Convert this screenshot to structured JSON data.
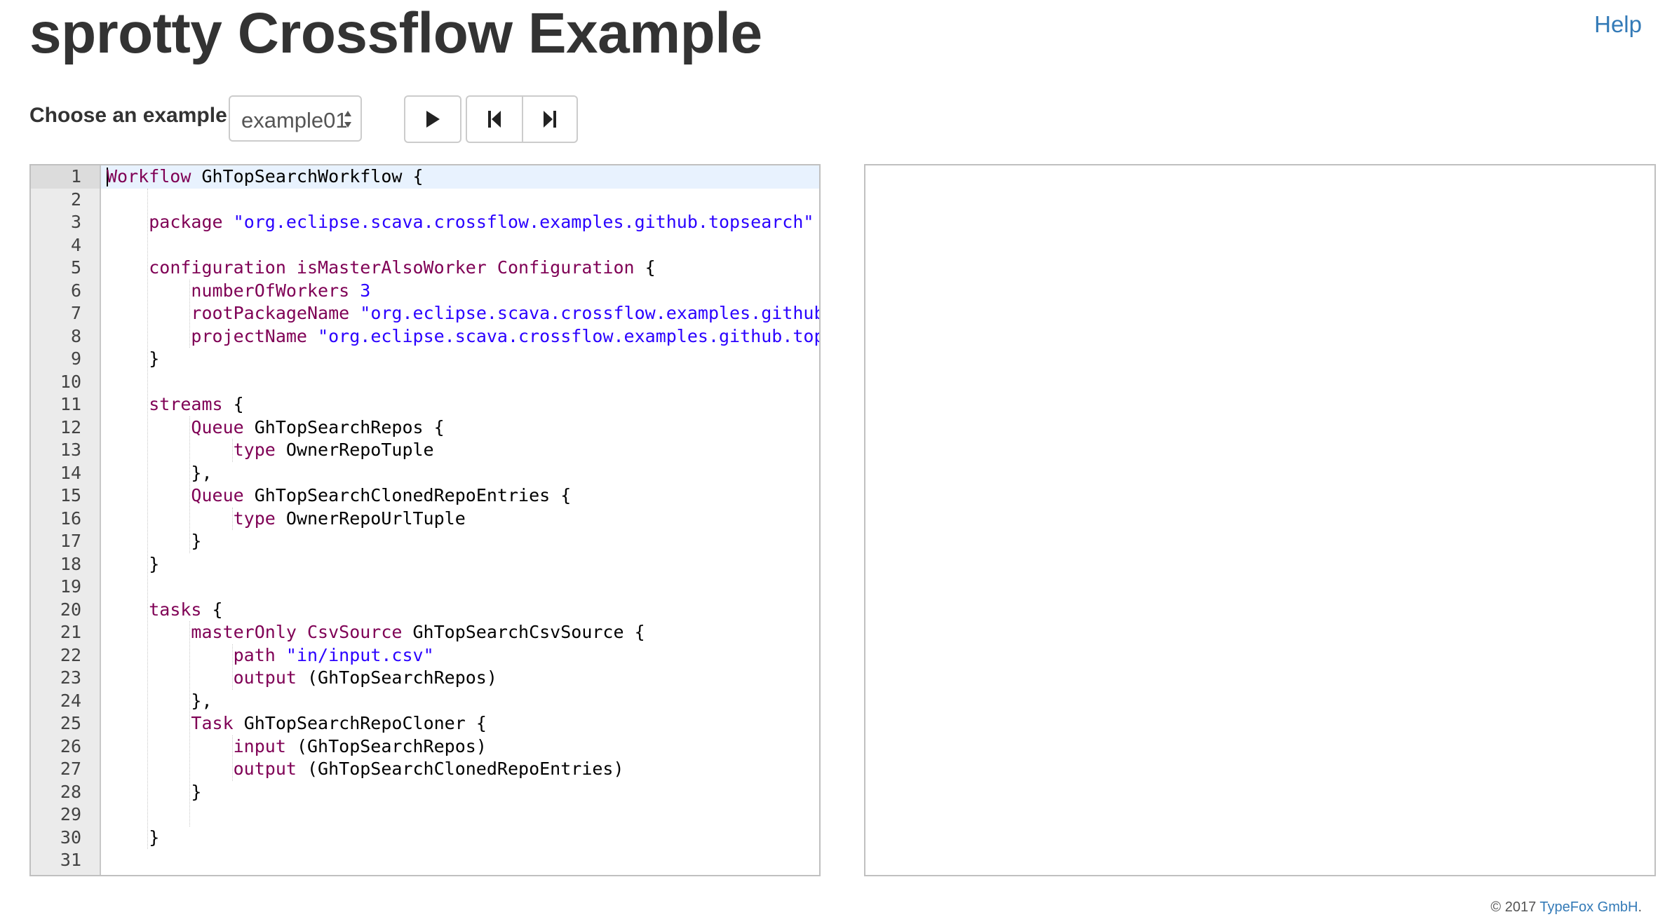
{
  "header": {
    "title": "sprotty Crossflow Example",
    "help_label": "Help"
  },
  "toolbar": {
    "choose_label": "Choose an example:",
    "selected_example": "example01",
    "buttons": [
      {
        "name": "play-button",
        "icon": "play-icon"
      },
      {
        "name": "previous-button",
        "icon": "skip-previous-icon"
      },
      {
        "name": "next-button",
        "icon": "skip-next-icon"
      }
    ]
  },
  "editor": {
    "active_line": 1,
    "lines": [
      [
        [
          "kw",
          "Workflow"
        ],
        [
          "p",
          " GhTopSearchWorkflow {"
        ]
      ],
      [],
      [
        [
          "p",
          "    "
        ],
        [
          "kw",
          "package"
        ],
        [
          "p",
          " "
        ],
        [
          "str",
          "\"org.eclipse.scava.crossflow.examples.github.topsearch\""
        ]
      ],
      [],
      [
        [
          "p",
          "    "
        ],
        [
          "kw",
          "configuration isMasterAlsoWorker Configuration"
        ],
        [
          "p",
          " {"
        ]
      ],
      [
        [
          "p",
          "        "
        ],
        [
          "kw",
          "numberOfWorkers"
        ],
        [
          "p",
          " "
        ],
        [
          "num",
          "3"
        ]
      ],
      [
        [
          "p",
          "        "
        ],
        [
          "kw",
          "rootPackageName"
        ],
        [
          "p",
          " "
        ],
        [
          "str",
          "\"org.eclipse.scava.crossflow.examples.github.topsearch\""
        ]
      ],
      [
        [
          "p",
          "        "
        ],
        [
          "kw",
          "projectName"
        ],
        [
          "p",
          " "
        ],
        [
          "str",
          "\"org.eclipse.scava.crossflow.examples.github.topsearch\""
        ]
      ],
      [
        [
          "p",
          "    }"
        ]
      ],
      [],
      [
        [
          "p",
          "    "
        ],
        [
          "kw",
          "streams"
        ],
        [
          "p",
          " {"
        ]
      ],
      [
        [
          "p",
          "        "
        ],
        [
          "kw",
          "Queue"
        ],
        [
          "p",
          " GhTopSearchRepos {"
        ]
      ],
      [
        [
          "p",
          "            "
        ],
        [
          "kw",
          "type"
        ],
        [
          "p",
          " OwnerRepoTuple"
        ]
      ],
      [
        [
          "p",
          "        },"
        ]
      ],
      [
        [
          "p",
          "        "
        ],
        [
          "kw",
          "Queue"
        ],
        [
          "p",
          " GhTopSearchClonedRepoEntries {"
        ]
      ],
      [
        [
          "p",
          "            "
        ],
        [
          "kw",
          "type"
        ],
        [
          "p",
          " OwnerRepoUrlTuple"
        ]
      ],
      [
        [
          "p",
          "        }"
        ]
      ],
      [
        [
          "p",
          "    }"
        ]
      ],
      [],
      [
        [
          "p",
          "    "
        ],
        [
          "kw",
          "tasks"
        ],
        [
          "p",
          " {"
        ]
      ],
      [
        [
          "p",
          "        "
        ],
        [
          "kw",
          "masterOnly CsvSource"
        ],
        [
          "p",
          " GhTopSearchCsvSource {"
        ]
      ],
      [
        [
          "p",
          "            "
        ],
        [
          "kw",
          "path"
        ],
        [
          "p",
          " "
        ],
        [
          "str",
          "\"in/input.csv\""
        ]
      ],
      [
        [
          "p",
          "            "
        ],
        [
          "kw",
          "output"
        ],
        [
          "p",
          " (GhTopSearchRepos)"
        ]
      ],
      [
        [
          "p",
          "        },"
        ]
      ],
      [
        [
          "p",
          "        "
        ],
        [
          "kw",
          "Task"
        ],
        [
          "p",
          " GhTopSearchRepoCloner {"
        ]
      ],
      [
        [
          "p",
          "            "
        ],
        [
          "kw",
          "input"
        ],
        [
          "p",
          " (GhTopSearchRepos)"
        ]
      ],
      [
        [
          "p",
          "            "
        ],
        [
          "kw",
          "output"
        ],
        [
          "p",
          " (GhTopSearchClonedRepoEntries)"
        ]
      ],
      [
        [
          "p",
          "        }"
        ]
      ],
      [],
      [
        [
          "p",
          "    }"
        ]
      ],
      []
    ]
  },
  "footer": {
    "copyright": "© 2017 ",
    "company": "TypeFox GmbH",
    "period": "."
  }
}
